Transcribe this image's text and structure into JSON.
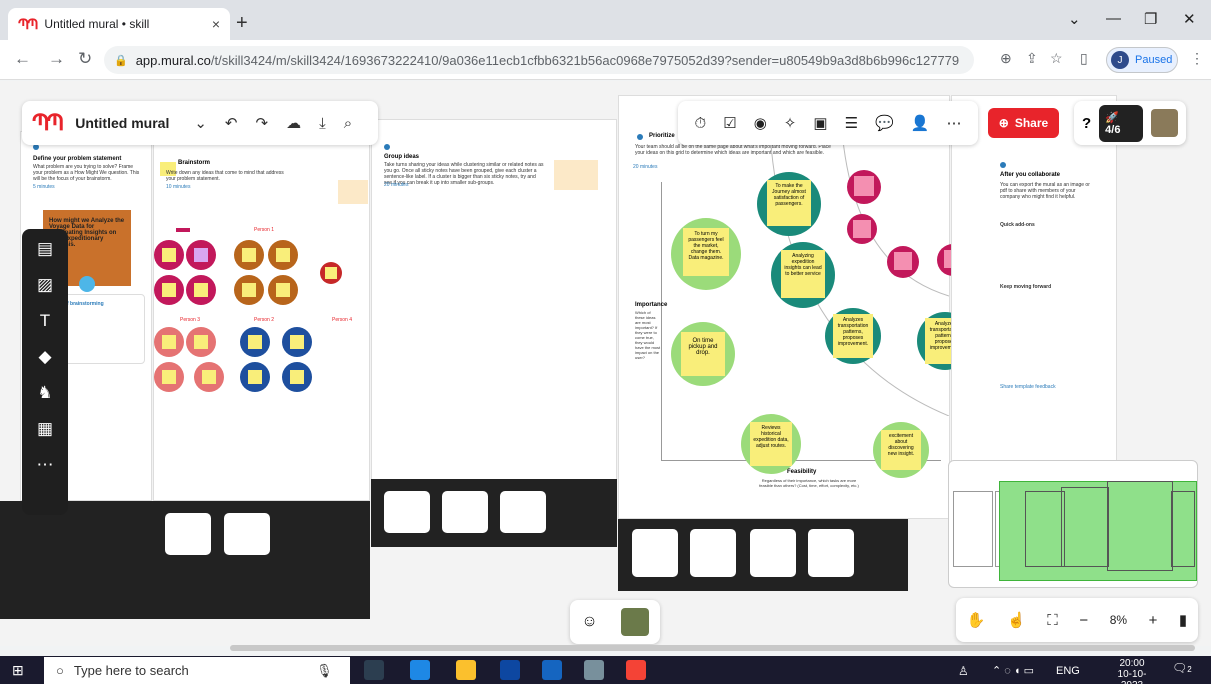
{
  "browser": {
    "tab_title": "Untitled mural • skill",
    "tab_logo": "ՊՊ",
    "close": "×",
    "newtab": "+",
    "url_host": "app.mural.co",
    "url_path": "/t/skill3424/m/skill3424/1693673222410/9a036e11ecb1cfbb6321b56ac0968e7975052d39?sender=u80549b9a3d8b6b996c127779",
    "profile_initial": "J",
    "profile_status": "Paused"
  },
  "mural": {
    "title": "Untitled mural",
    "share_label": "Share",
    "progress": "4/6",
    "zoom": "8%",
    "zoom_minus": "−",
    "zoom_plus": "+"
  },
  "sections": {
    "define_title": "Define your problem statement",
    "define_body": "What problem are you trying to solve? Frame your problem as a How Might We question. This will be the focus of your brainstorm.",
    "define_time": "5 minutes",
    "hmw_text": "How might we Analyze the Voyage Data for Illuminating Insights on Uber expeditionary Analysis.",
    "rules_title": "Key rules of brainstorming",
    "brainstorm_title": "Brainstorm",
    "brainstorm_body": "Write down any ideas that come to mind that address your problem statement.",
    "brainstorm_time": "10 minutes",
    "person1": "Person 1",
    "person2": "Person 2",
    "person3": "Person 3",
    "person4": "Person 4",
    "group_title": "Group ideas",
    "group_body": "Take turns sharing your ideas while clustering similar or related notes as you go. Once all sticky notes have been grouped, give each cluster a sentence-like label. If a cluster is bigger than six sticky notes, try and see if you can break it up into smaller sub-groups.",
    "group_time": "20 minutes",
    "prioritize_title": "Prioritize",
    "prioritize_body": "Your team should all be on the same page about what's important moving forward. Place your ideas on this grid to determine which ideas are important and which are feasible.",
    "prioritize_time": "20 minutes",
    "importance_label": "Importance",
    "importance_desc": "Which of these ideas are most important? If they were to come true, they would have the most impact on the user?",
    "feasibility_label": "Feasibility",
    "feasibility_desc": "Regardless of their importance, which tasks are more feasible than others? (Cost, time, effort, complexity, etc.)",
    "after_title": "After you collaborate",
    "after_body": "You can export the mural as an image or pdf to share with members of your company who might find it helpful.",
    "quick_addons": "Quick add-ons",
    "keep_moving": "Keep moving forward",
    "share_feedback": "Share template feedback"
  },
  "notes": {
    "journey": "To make the Journey almost satisfaction of passengers.",
    "analyzing": "Analyzing expedition insights can lead to better service",
    "turning": "To turn my passengers feel the market, change them. Data magazine.",
    "ontime": "On time pickup and drop.",
    "analyze1": "Analyzes transportation patterns, proposes improvement.",
    "analyze2": "Analyzes transportation patterns, proposes improvement.",
    "reviews": "Reviews historical expedition data, adjust routes.",
    "excitement": "excitement about discovering new insight."
  },
  "taskbar": {
    "search_placeholder": "Type here to search",
    "lang": "ENG",
    "time": "20:00",
    "date": "10-10-2023",
    "notif_count": "2"
  }
}
